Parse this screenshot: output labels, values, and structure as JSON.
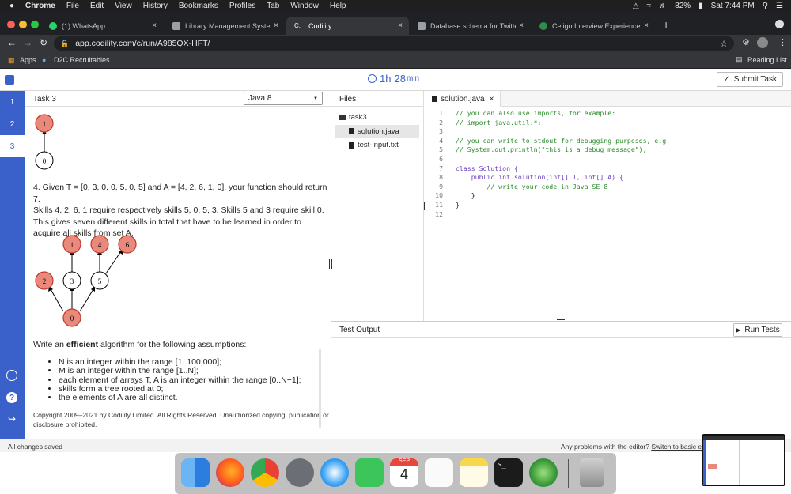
{
  "menubar": {
    "app": "Chrome",
    "items": [
      "File",
      "Edit",
      "View",
      "History",
      "Bookmarks",
      "Profiles",
      "Tab",
      "Window",
      "Help"
    ],
    "battery": "82%",
    "clock": "Sat 7:44 PM"
  },
  "browser": {
    "tabs": [
      {
        "label": "(1) WhatsApp",
        "favicon_color": "#25d366"
      },
      {
        "label": "Library Management System D",
        "favicon_color": "#9aa0a6"
      },
      {
        "label": "Codility",
        "favicon_color": "#ffffff",
        "favicon_text": "C."
      },
      {
        "label": "Database schema for Twitter -",
        "favicon_color": "#9aa0a6"
      },
      {
        "label": "Celigo Interview Experience | G",
        "favicon_color": "#2f8d46"
      }
    ],
    "url": "app.codility.com/c/run/A985QX-HFT/",
    "bookmarks": {
      "apps": "Apps",
      "item1": "D2C Recruitables...",
      "reading_list": "Reading List"
    }
  },
  "header": {
    "timer_hours": "1h",
    "timer_minutes": "28",
    "timer_unit": "min",
    "submit_label": "Submit Task"
  },
  "rail": {
    "tasks": [
      "1",
      "2",
      "3"
    ],
    "active": "3"
  },
  "task": {
    "title": "Task 3",
    "language": "Java 8",
    "example4_lines": [
      "4. Given T = [0, 3, 0, 0, 5, 0, 5] and A = [4, 2, 6, 1, 0], your function should return 7.",
      "Skills 4, 2, 6, 1 require respectively skills 5, 0, 5, 3. Skills 5 and 3 require skill 0.",
      "This gives seven different skills in total that have to be learned in order to",
      "acquire all skills from set A."
    ],
    "assumptions_prefix": "Write an ",
    "assumptions_bold": "efficient",
    "assumptions_suffix": " algorithm for the following assumptions:",
    "assumptions": [
      "N is an integer within the range [1..100,000];",
      "M is an integer within the range [1..N];",
      "each element of arrays T, A is an integer within the range [0..N−1];",
      "skills form a tree rooted at 0;",
      "the elements of A are all distinct."
    ],
    "copyright_line1": "Copyright 2009–2021 by Codility Limited. All Rights Reserved. Unauthorized copying, publication or",
    "copyright_line2": "disclosure prohibited.",
    "tree_top": {
      "node_red": "1",
      "node_white": "0"
    },
    "tree_main": {
      "node0": "0",
      "node1": "1",
      "node2": "2",
      "node3": "3",
      "node4": "4",
      "node5": "5",
      "node6": "6"
    }
  },
  "files": {
    "title": "Files",
    "folder": "task3",
    "items": [
      "solution.java",
      "test-input.txt"
    ]
  },
  "editor": {
    "tab": "solution.java",
    "lines": [
      {
        "n": "1",
        "text": "// you can also use imports, for example:"
      },
      {
        "n": "2",
        "text": "// import java.util.*;"
      },
      {
        "n": "3",
        "text": ""
      },
      {
        "n": "4",
        "text": "// you can write to stdout for debugging purposes, e.g."
      },
      {
        "n": "5",
        "text": "// System.out.println(\"this is a debug message\");"
      },
      {
        "n": "6",
        "text": ""
      },
      {
        "n": "7",
        "text": "class Solution {"
      },
      {
        "n": "8",
        "text": "    public int solution(int[] T, int[] A) {"
      },
      {
        "n": "9",
        "text": "        // write your code in Java SE 8"
      },
      {
        "n": "10",
        "text": "    }"
      },
      {
        "n": "11",
        "text": "}"
      },
      {
        "n": "12",
        "text": ""
      }
    ]
  },
  "output": {
    "title": "Test Output",
    "run_label": "Run Tests"
  },
  "status": {
    "saved": "All changes saved",
    "problems": "Any problems with the editor? ",
    "switch_link": "Switch to basic editor"
  },
  "dock": {
    "calendar_month": "SEP",
    "calendar_day": "4"
  },
  "colors": {
    "accent": "#3a61c9",
    "node_red": "#e8897c",
    "node_stroke": "#c0392b"
  }
}
